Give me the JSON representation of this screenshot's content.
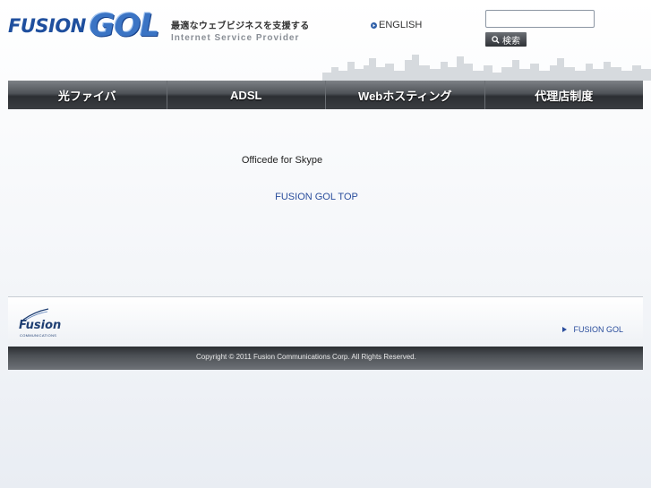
{
  "header": {
    "logo_fusion": "FUSION",
    "logo_gol": "GOL",
    "tagline_jp": "最適なウェブビジネスを支援する",
    "tagline_en": "Internet Service Provider",
    "english_link": "ENGLISH",
    "search": {
      "value": "",
      "placeholder": "",
      "button_label": "検索"
    }
  },
  "nav": {
    "items": [
      {
        "label": "光ファイバ"
      },
      {
        "label": "ADSL"
      },
      {
        "label": "Webホスティング"
      },
      {
        "label": "代理店制度"
      }
    ]
  },
  "main": {
    "title": "Officede for Skype",
    "top_link": "FUSION GOL TOP"
  },
  "footer": {
    "logo_text": "Fusion",
    "logo_sub": "COMMUNICATIONS",
    "link": "FUSION GOL",
    "copyright": "Copyright © 2011 Fusion Communications Corp. All Rights Reserved."
  },
  "colors": {
    "brand_blue": "#1f4f9e",
    "link_blue": "#2a4d9c",
    "nav_dark": "#2c2f33"
  }
}
